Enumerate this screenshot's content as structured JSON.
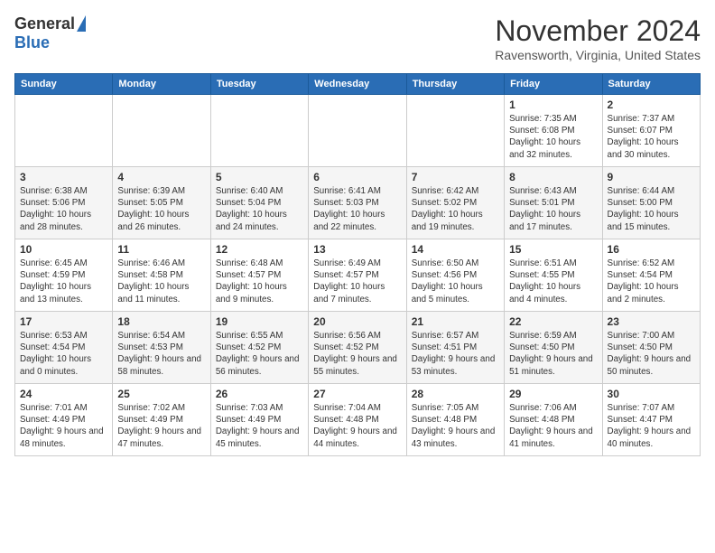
{
  "header": {
    "logo_general": "General",
    "logo_blue": "Blue",
    "month_title": "November 2024",
    "subtitle": "Ravensworth, Virginia, United States"
  },
  "days_of_week": [
    "Sunday",
    "Monday",
    "Tuesday",
    "Wednesday",
    "Thursday",
    "Friday",
    "Saturday"
  ],
  "weeks": [
    [
      {
        "day": "",
        "info": ""
      },
      {
        "day": "",
        "info": ""
      },
      {
        "day": "",
        "info": ""
      },
      {
        "day": "",
        "info": ""
      },
      {
        "day": "",
        "info": ""
      },
      {
        "day": "1",
        "info": "Sunrise: 7:35 AM\nSunset: 6:08 PM\nDaylight: 10 hours and 32 minutes."
      },
      {
        "day": "2",
        "info": "Sunrise: 7:37 AM\nSunset: 6:07 PM\nDaylight: 10 hours and 30 minutes."
      }
    ],
    [
      {
        "day": "3",
        "info": "Sunrise: 6:38 AM\nSunset: 5:06 PM\nDaylight: 10 hours and 28 minutes."
      },
      {
        "day": "4",
        "info": "Sunrise: 6:39 AM\nSunset: 5:05 PM\nDaylight: 10 hours and 26 minutes."
      },
      {
        "day": "5",
        "info": "Sunrise: 6:40 AM\nSunset: 5:04 PM\nDaylight: 10 hours and 24 minutes."
      },
      {
        "day": "6",
        "info": "Sunrise: 6:41 AM\nSunset: 5:03 PM\nDaylight: 10 hours and 22 minutes."
      },
      {
        "day": "7",
        "info": "Sunrise: 6:42 AM\nSunset: 5:02 PM\nDaylight: 10 hours and 19 minutes."
      },
      {
        "day": "8",
        "info": "Sunrise: 6:43 AM\nSunset: 5:01 PM\nDaylight: 10 hours and 17 minutes."
      },
      {
        "day": "9",
        "info": "Sunrise: 6:44 AM\nSunset: 5:00 PM\nDaylight: 10 hours and 15 minutes."
      }
    ],
    [
      {
        "day": "10",
        "info": "Sunrise: 6:45 AM\nSunset: 4:59 PM\nDaylight: 10 hours and 13 minutes."
      },
      {
        "day": "11",
        "info": "Sunrise: 6:46 AM\nSunset: 4:58 PM\nDaylight: 10 hours and 11 minutes."
      },
      {
        "day": "12",
        "info": "Sunrise: 6:48 AM\nSunset: 4:57 PM\nDaylight: 10 hours and 9 minutes."
      },
      {
        "day": "13",
        "info": "Sunrise: 6:49 AM\nSunset: 4:57 PM\nDaylight: 10 hours and 7 minutes."
      },
      {
        "day": "14",
        "info": "Sunrise: 6:50 AM\nSunset: 4:56 PM\nDaylight: 10 hours and 5 minutes."
      },
      {
        "day": "15",
        "info": "Sunrise: 6:51 AM\nSunset: 4:55 PM\nDaylight: 10 hours and 4 minutes."
      },
      {
        "day": "16",
        "info": "Sunrise: 6:52 AM\nSunset: 4:54 PM\nDaylight: 10 hours and 2 minutes."
      }
    ],
    [
      {
        "day": "17",
        "info": "Sunrise: 6:53 AM\nSunset: 4:54 PM\nDaylight: 10 hours and 0 minutes."
      },
      {
        "day": "18",
        "info": "Sunrise: 6:54 AM\nSunset: 4:53 PM\nDaylight: 9 hours and 58 minutes."
      },
      {
        "day": "19",
        "info": "Sunrise: 6:55 AM\nSunset: 4:52 PM\nDaylight: 9 hours and 56 minutes."
      },
      {
        "day": "20",
        "info": "Sunrise: 6:56 AM\nSunset: 4:52 PM\nDaylight: 9 hours and 55 minutes."
      },
      {
        "day": "21",
        "info": "Sunrise: 6:57 AM\nSunset: 4:51 PM\nDaylight: 9 hours and 53 minutes."
      },
      {
        "day": "22",
        "info": "Sunrise: 6:59 AM\nSunset: 4:50 PM\nDaylight: 9 hours and 51 minutes."
      },
      {
        "day": "23",
        "info": "Sunrise: 7:00 AM\nSunset: 4:50 PM\nDaylight: 9 hours and 50 minutes."
      }
    ],
    [
      {
        "day": "24",
        "info": "Sunrise: 7:01 AM\nSunset: 4:49 PM\nDaylight: 9 hours and 48 minutes."
      },
      {
        "day": "25",
        "info": "Sunrise: 7:02 AM\nSunset: 4:49 PM\nDaylight: 9 hours and 47 minutes."
      },
      {
        "day": "26",
        "info": "Sunrise: 7:03 AM\nSunset: 4:49 PM\nDaylight: 9 hours and 45 minutes."
      },
      {
        "day": "27",
        "info": "Sunrise: 7:04 AM\nSunset: 4:48 PM\nDaylight: 9 hours and 44 minutes."
      },
      {
        "day": "28",
        "info": "Sunrise: 7:05 AM\nSunset: 4:48 PM\nDaylight: 9 hours and 43 minutes."
      },
      {
        "day": "29",
        "info": "Sunrise: 7:06 AM\nSunset: 4:48 PM\nDaylight: 9 hours and 41 minutes."
      },
      {
        "day": "30",
        "info": "Sunrise: 7:07 AM\nSunset: 4:47 PM\nDaylight: 9 hours and 40 minutes."
      }
    ]
  ]
}
